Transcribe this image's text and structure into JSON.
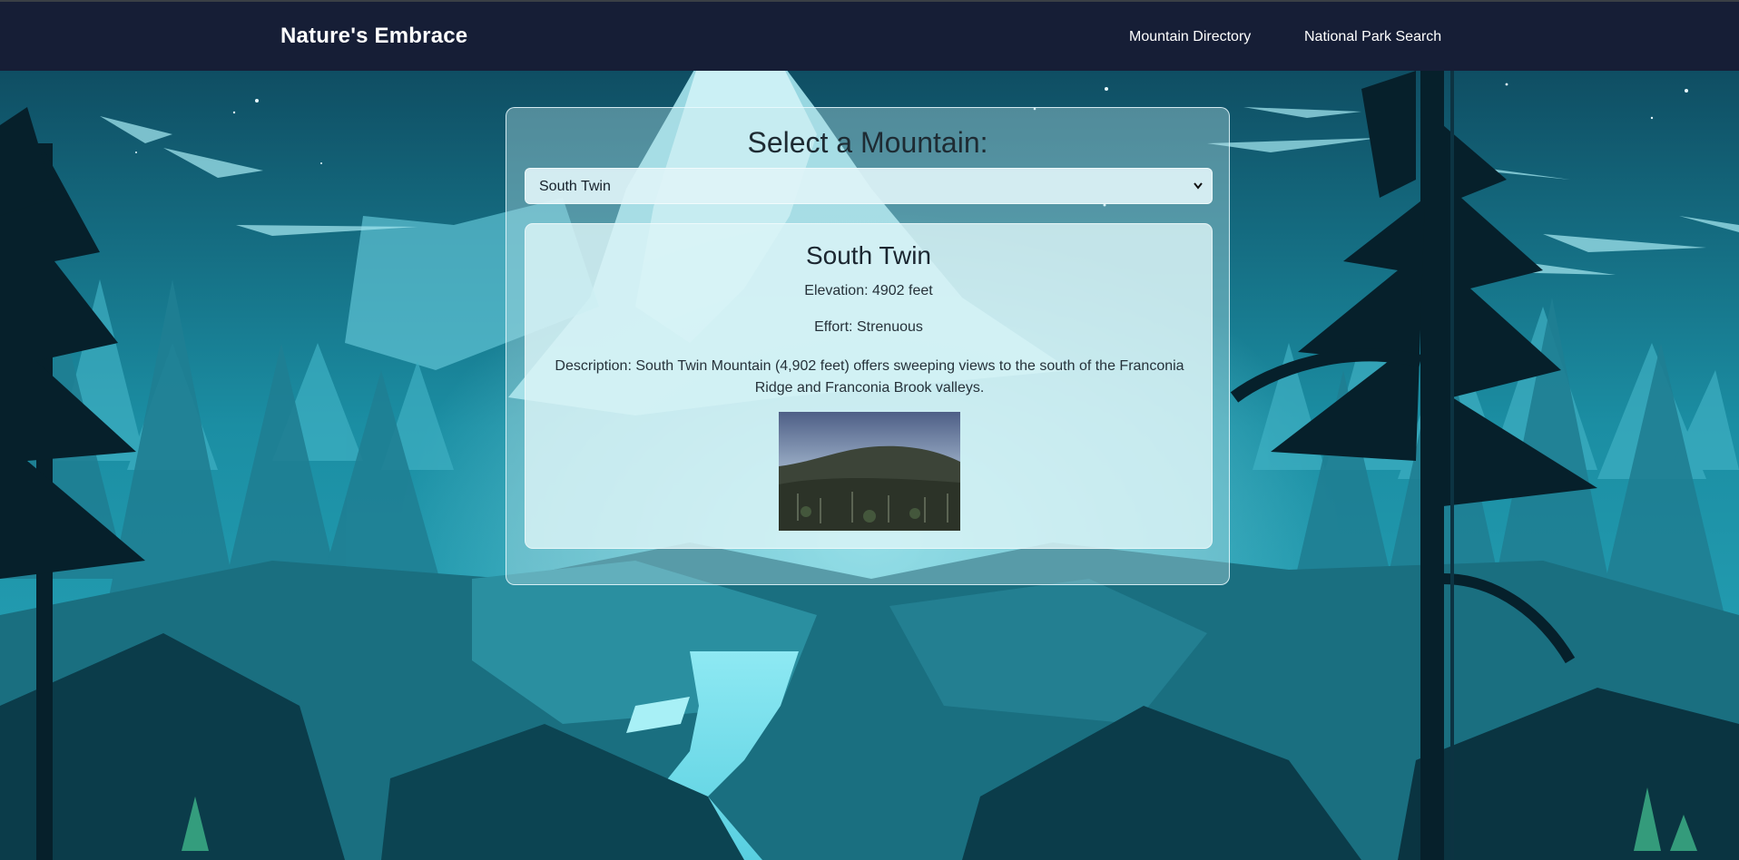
{
  "navbar": {
    "brand": "Nature's Embrace",
    "links": [
      "Mountain Directory",
      "National Park Search"
    ]
  },
  "panel": {
    "title": "Select a Mountain:",
    "select": {
      "selected": "South Twin"
    }
  },
  "mountain": {
    "name": "South Twin",
    "elevation_label": "Elevation:",
    "elevation_value": "4902 feet",
    "effort_label": "Effort:",
    "effort_value": "Strenuous",
    "description_label": "Description:",
    "description_value": "South Twin Mountain (4,902 feet) offers sweeping views to the south of the Franconia Ridge and Franconia Brook valleys."
  },
  "colors": {
    "navbar_bg": "#161e36",
    "sky": "#1a7f93",
    "mist": "#6fd6e4",
    "silhouette": "#06202b"
  }
}
